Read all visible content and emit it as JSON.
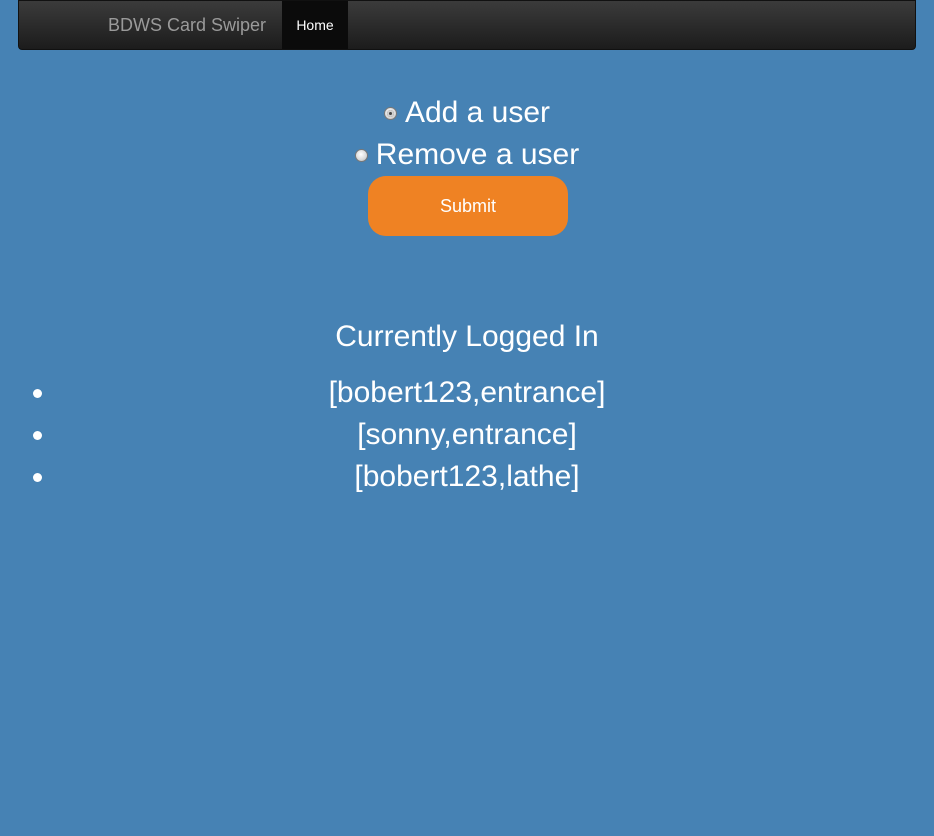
{
  "navbar": {
    "brand": "BDWS Card Swiper",
    "items": [
      {
        "label": "Home",
        "active": true
      }
    ]
  },
  "form": {
    "options": [
      {
        "label": "Add a user",
        "checked": true
      },
      {
        "label": "Remove a user",
        "checked": false
      }
    ],
    "submit_label": "Submit"
  },
  "logged_in": {
    "title": "Currently Logged In",
    "entries": [
      "[bobert123,entrance]",
      "[sonny,entrance]",
      "[bobert123,lathe]"
    ]
  },
  "colors": {
    "background": "#4682b4",
    "submit": "#ef8223",
    "navbar": "#222222"
  }
}
